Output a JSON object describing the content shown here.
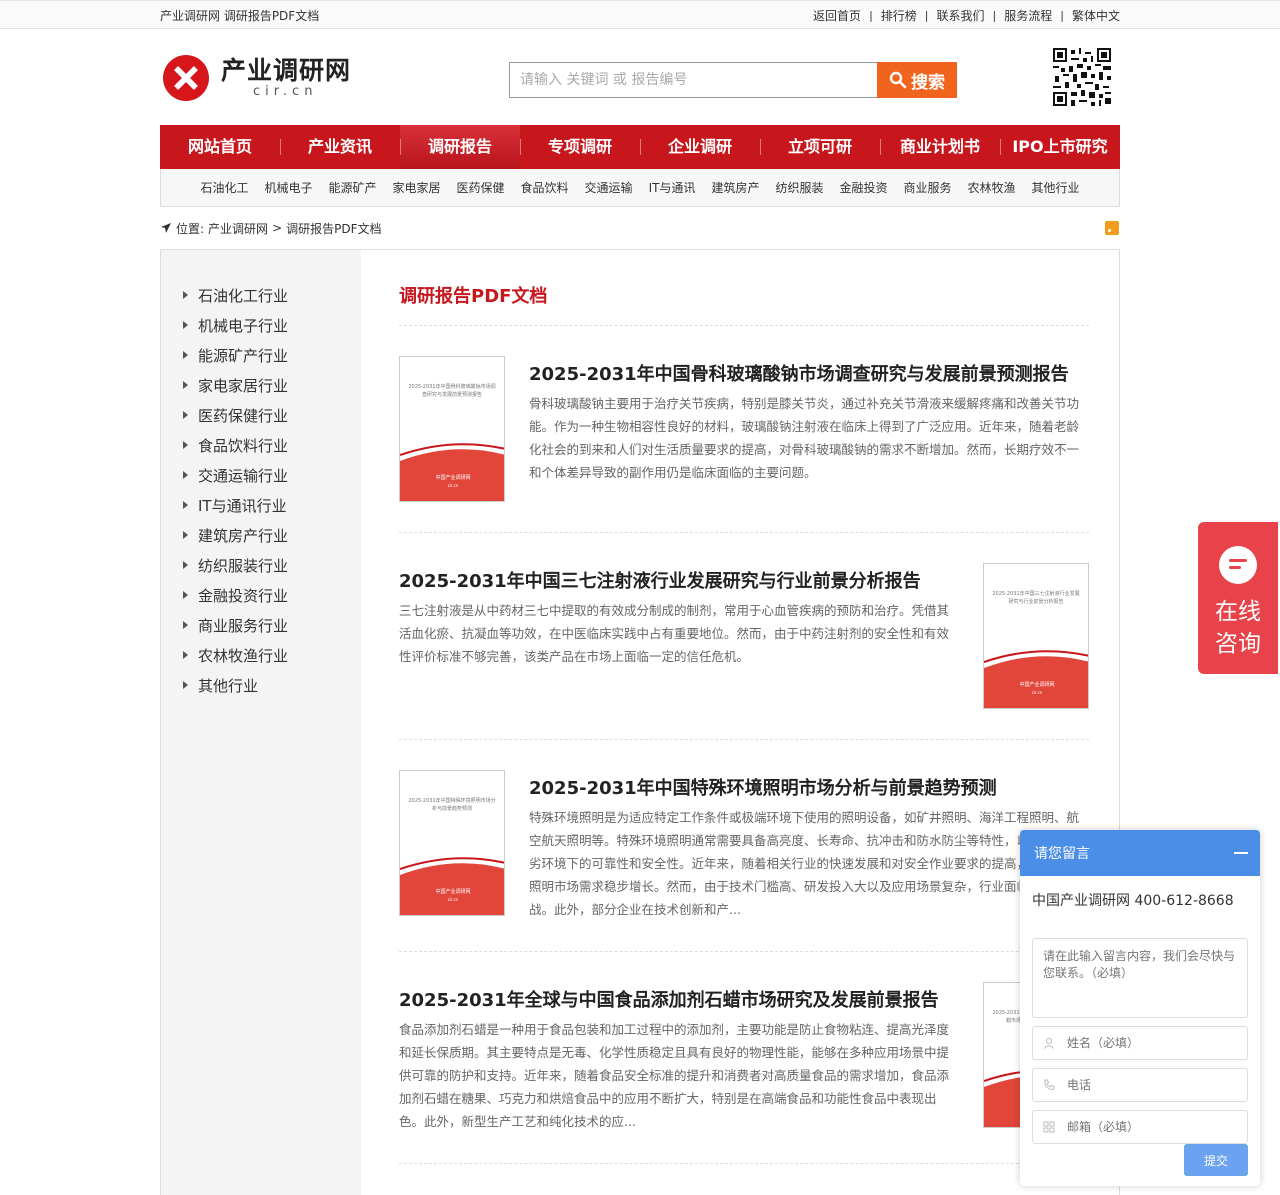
{
  "topbar": {
    "breadcrumb": "产业调研网 调研报告PDF文档",
    "links": [
      "返回首页",
      "排行榜",
      "联系我们",
      "服务流程",
      "繁体中文"
    ]
  },
  "header": {
    "logo_cn": "产业调研网",
    "logo_en": "cir.cn",
    "search_placeholder": "请输入 关键词 或 报告编号",
    "search_button": "搜索"
  },
  "mainnav": [
    "网站首页",
    "产业资讯",
    "调研报告",
    "专项调研",
    "企业调研",
    "立项可研",
    "商业计划书",
    "IPO上市研究"
  ],
  "subnav": [
    "石油化工",
    "机械电子",
    "能源矿产",
    "家电家居",
    "医药保健",
    "食品饮料",
    "交通运输",
    "IT与通讯",
    "建筑房产",
    "纺织服装",
    "金融投资",
    "商业服务",
    "农林牧渔",
    "其他行业"
  ],
  "crumb": {
    "label": "位置:",
    "home": "产业调研网",
    "sep": ">",
    "current": "调研报告PDF文档"
  },
  "sidebar": [
    "石油化工行业",
    "机械电子行业",
    "能源矿产行业",
    "家电家居行业",
    "医药保健行业",
    "食品饮料行业",
    "交通运输行业",
    "IT与通讯行业",
    "建筑房产行业",
    "纺织服装行业",
    "金融投资行业",
    "商业服务行业",
    "农林牧渔行业",
    "其他行业"
  ],
  "page_title": "调研报告PDF文档",
  "reports": [
    {
      "title": "2025-2031年中国骨科玻璃酸钠市场调查研究与发展前景预测报告",
      "cover_title": "2025-2031年中国骨科玻璃酸钠市场调查研究与发展前景预测报告",
      "desc": "骨科玻璃酸钠主要用于治疗关节疾病，特别是膝关节炎，通过补充关节滑液来缓解疼痛和改善关节功能。作为一种生物相容性良好的材料，玻璃酸钠注射液在临床上得到了广泛应用。近年来，随着老龄化社会的到来和人们对生活质量要求的提高，对骨科玻璃酸钠的需求不断增加。然而，长期疗效不一和个体差异导致的副作用仍是临床面临的主要问题。"
    },
    {
      "title": "2025-2031年中国三七注射液行业发展研究与行业前景分析报告",
      "cover_title": "2025-2031年中国三七注射液行业发展研究与行业前景分析报告",
      "desc": "三七注射液是从中药材三七中提取的有效成分制成的制剂，常用于心血管疾病的预防和治疗。凭借其活血化瘀、抗凝血等功效，在中医临床实践中占有重要地位。然而，由于中药注射剂的安全性和有效性评价标准不够完善，该类产品在市场上面临一定的信任危机。"
    },
    {
      "title": "2025-2031年中国特殊环境照明市场分析与前景趋势预测",
      "cover_title": "2025-2031年中国特殊环境照明市场分析与前景趋势预测",
      "desc": "特殊环境照明是为适应特定工作条件或极端环境下使用的照明设备，如矿井照明、海洋工程照明、航空航天照明等。特殊环境照明通常需要具备高亮度、长寿命、抗冲击和防水防尘等特性，以确保在恶劣环境下的可靠性和安全性。近年来，随着相关行业的快速发展和对安全作业要求的提高，特殊环境照明市场需求稳步增长。然而，由于技术门槛高、研发投入大以及应用场景复杂，行业面临较大的挑战。此外，部分企业在技术创新和产..."
    },
    {
      "title": "2025-2031年全球与中国食品添加剂石蜡市场研究及发展前景报告",
      "cover_title": "2025-2031年全球与中国食品添加剂石蜡市场研究及发展前景报告",
      "desc": "食品添加剂石蜡是一种用于食品包装和加工过程中的添加剂，主要功能是防止食物粘连、提高光泽度和延长保质期。其主要特点是无毒、化学性质稳定且具有良好的物理性能，能够在多种应用场景中提供可靠的防护和支持。近年来，随着食品安全标准的提升和消费者对高质量食品的需求增加，食品添加剂石蜡在糖果、巧克力和烘焙食品中的应用不断扩大，特别是在高端食品和功能性食品中表现出色。此外，新型生产工艺和纯化技术的应..."
    }
  ],
  "cover_footer": "中国产业调研网",
  "cover_url": "cir.cn",
  "float_consult": {
    "line1": "在线",
    "line2": "咨询"
  },
  "msgbox": {
    "title": "请您留言",
    "company": "中国产业调研网 400-612-8668",
    "textarea_placeholder": "请在此输入留言内容，我们会尽快与您联系。（必填）",
    "name_placeholder": "姓名（必填）",
    "phone_placeholder": "电话",
    "email_placeholder": "邮箱（必填）",
    "submit": "提交"
  },
  "colors": {
    "brand_red": "#c8161d",
    "search_orange": "#f0641e",
    "widget_blue": "#4a8ee8"
  }
}
